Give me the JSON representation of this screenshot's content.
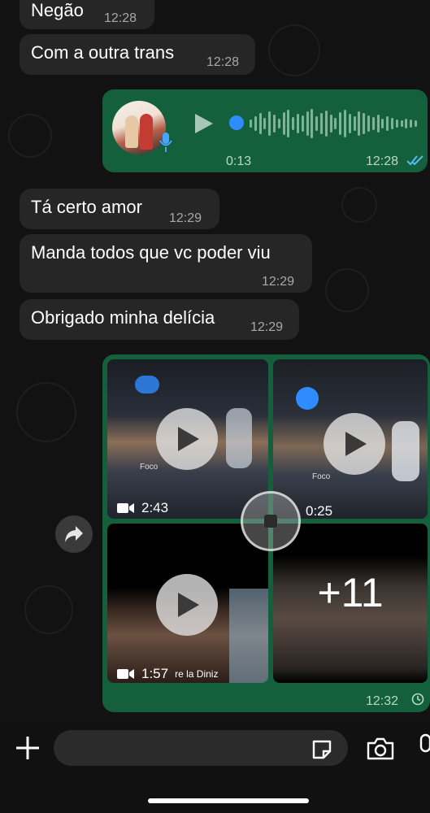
{
  "messages": [
    {
      "text": "Negão",
      "time": "12:28"
    },
    {
      "text": "Com a outra trans",
      "time": "12:28"
    },
    {
      "text": "Tá certo amor",
      "time": "12:29"
    },
    {
      "text": "Manda todos que vc poder viu",
      "time": "12:29"
    },
    {
      "text": "Obrigado minha delícia",
      "time": "12:29"
    }
  ],
  "voice": {
    "duration": "0:13",
    "time": "12:28",
    "status_icon": "double-check-icon",
    "progress": 0
  },
  "media": {
    "videos": [
      {
        "duration": "2:43",
        "label": "Foco"
      },
      {
        "duration": "0:25",
        "label": "Foco"
      },
      {
        "duration": "1:57",
        "caption": "re la Diniz"
      }
    ],
    "more_count": "+11",
    "time": "12:32",
    "status_icon": "clock-icon"
  },
  "colors": {
    "outgoing": "#145f3c",
    "incoming": "#262626",
    "read_ticks": "#53bdeb",
    "accent": "#2f8cff"
  },
  "composer": {
    "placeholder": "",
    "value": ""
  }
}
